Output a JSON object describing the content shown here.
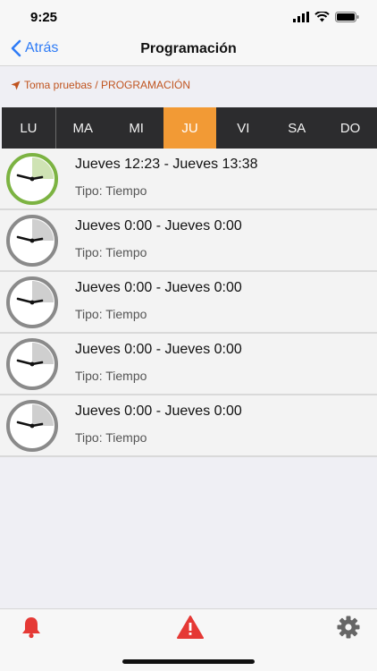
{
  "status_bar": {
    "time": "9:25"
  },
  "nav": {
    "back_label": "Atrás",
    "title": "Programación"
  },
  "breadcrumb": {
    "text": "Toma pruebas / PROGRAMACIÓN"
  },
  "days": {
    "items": [
      "LU",
      "MA",
      "MI",
      "JU",
      "VI",
      "SA",
      "DO"
    ],
    "active": "JU"
  },
  "schedule": [
    {
      "range": "Jueves 12:23 - Jueves 13:38",
      "tipo": "Tipo: Tiempo",
      "state": "active",
      "color": "#7cb342"
    },
    {
      "range": "Jueves 0:00 - Jueves 0:00",
      "tipo": "Tipo: Tiempo",
      "state": "inactive",
      "color": "#8a8a8a"
    },
    {
      "range": "Jueves 0:00 - Jueves 0:00",
      "tipo": "Tipo: Tiempo",
      "state": "inactive",
      "color": "#8a8a8a"
    },
    {
      "range": "Jueves 0:00 - Jueves 0:00",
      "tipo": "Tipo: Tiempo",
      "state": "inactive",
      "color": "#8a8a8a"
    },
    {
      "range": "Jueves 0:00 - Jueves 0:00",
      "tipo": "Tipo: Tiempo",
      "state": "inactive",
      "color": "#8a8a8a"
    }
  ],
  "tabbar": {
    "items": [
      {
        "icon": "bell-icon",
        "color": "#e53935"
      },
      {
        "icon": "warning-icon",
        "color": "#e53935"
      },
      {
        "icon": "gear-icon",
        "color": "#666666"
      }
    ]
  },
  "colors": {
    "accent": "#f29a35",
    "link": "#2f7cf6",
    "breadcrumb": "#c0541f",
    "day_bar": "#2c2c2e"
  }
}
